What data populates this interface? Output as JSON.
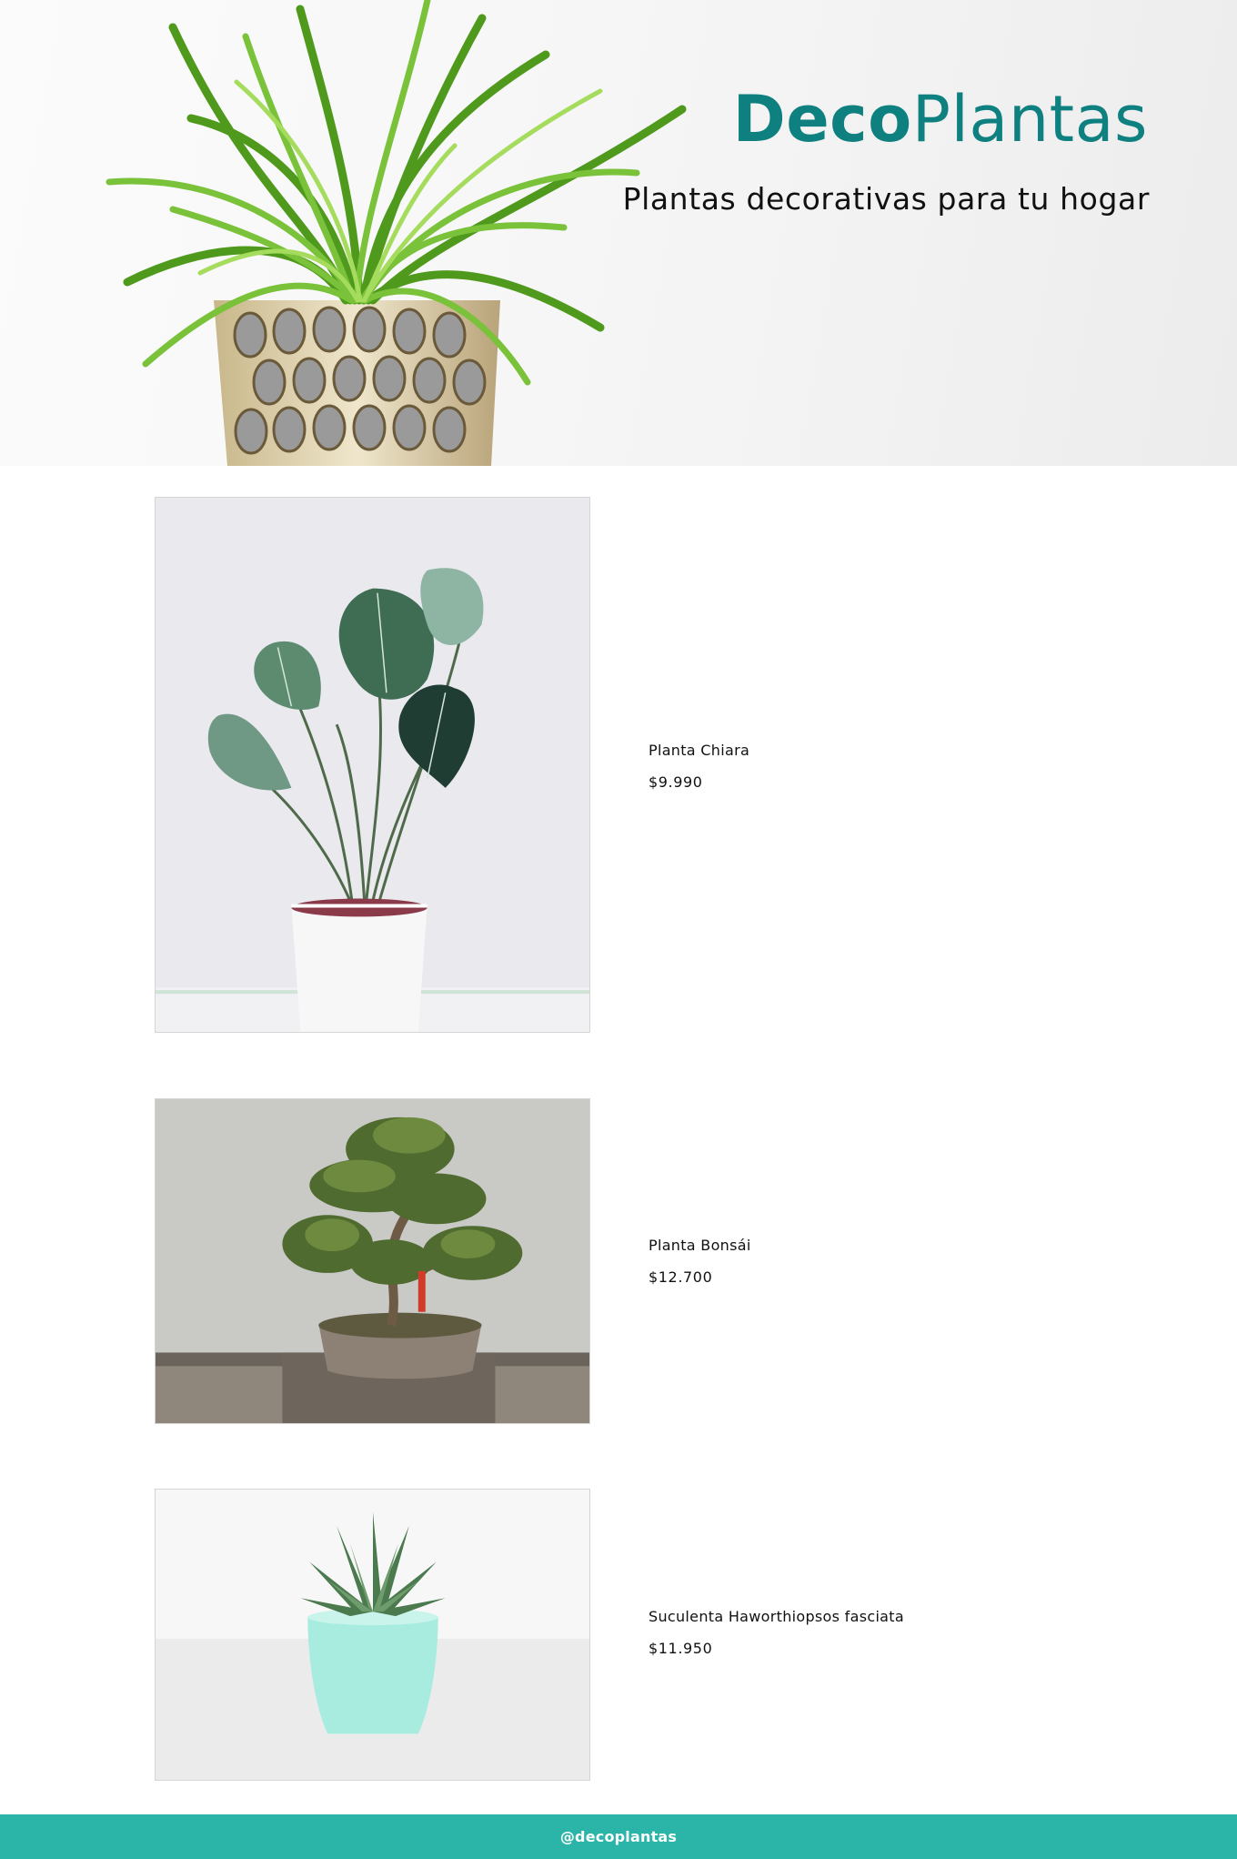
{
  "header": {
    "brand_part1": "Deco",
    "brand_part2": "Plantas",
    "tagline": "Plantas decorativas para tu hogar",
    "brand_color": "#0f8080"
  },
  "products": [
    {
      "name": "Planta Chiara",
      "price": "$9.990"
    },
    {
      "name": "Planta Bonsái",
      "price": "$12.700"
    },
    {
      "name": "Suculenta Haworthiopsos fasciata",
      "price": "$11.950"
    }
  ],
  "footer": {
    "handle": "@decoplantas",
    "background": "#2bb5a8"
  }
}
